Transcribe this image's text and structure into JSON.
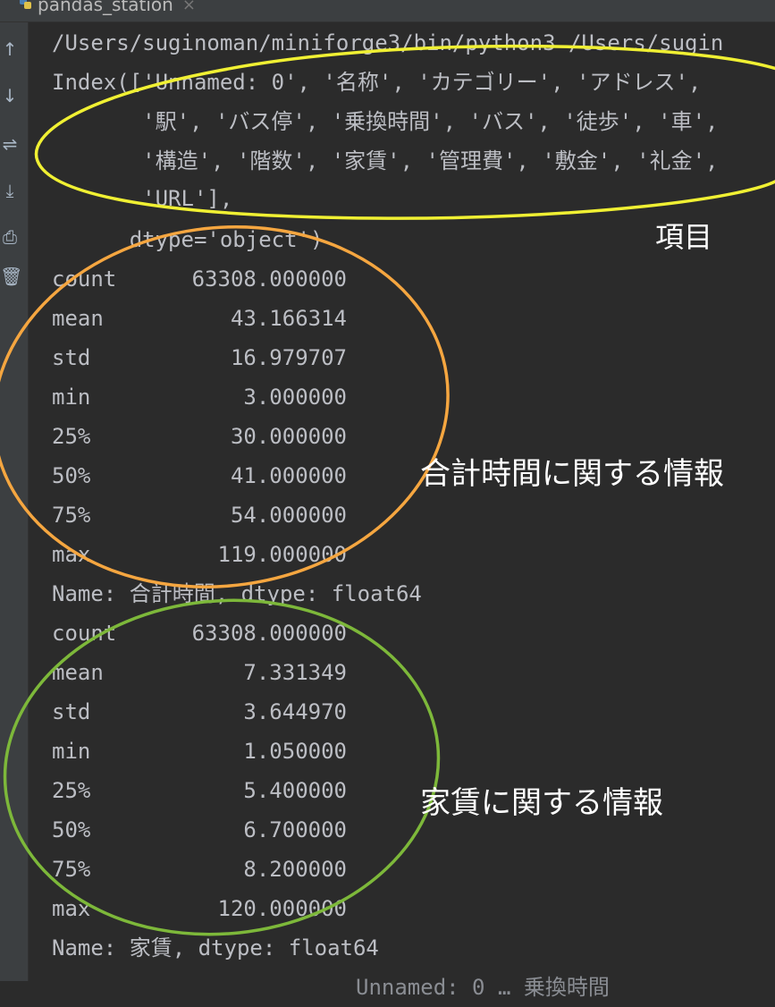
{
  "tab": {
    "title": "pandas_station",
    "close_glyph": "×",
    "icon": "python-file-icon"
  },
  "gutter_icons": [
    "↑",
    "↓",
    "⇌",
    "⤓",
    "⎙",
    "🗑"
  ],
  "console": {
    "cmd": "/Users/suginoman/miniforge3/bin/python3 /Users/sugin",
    "index_lines": [
      "Index(['Unnamed: 0', '名称', 'カテゴリー', 'アドレス',",
      "       '駅', 'バス停', '乗換時間', 'バス', '徒歩', '車',",
      "       '構造', '階数', '家賃', '管理費', '敷金', '礼金',",
      "       'URL'],",
      "      dtype='object')"
    ],
    "stats1": [
      {
        "k": "count",
        "v": "63308.000000"
      },
      {
        "k": "mean",
        "v": "43.166314"
      },
      {
        "k": "std",
        "v": "16.979707"
      },
      {
        "k": "min",
        "v": "3.000000"
      },
      {
        "k": "25%",
        "v": "30.000000"
      },
      {
        "k": "50%",
        "v": "41.000000"
      },
      {
        "k": "75%",
        "v": "54.000000"
      },
      {
        "k": "max",
        "v": "119.000000"
      }
    ],
    "name1": "Name: 合計時間, dtype: float64",
    "stats2": [
      {
        "k": "count",
        "v": "63308.000000"
      },
      {
        "k": "mean",
        "v": "7.331349"
      },
      {
        "k": "std",
        "v": "3.644970"
      },
      {
        "k": "min",
        "v": "1.050000"
      },
      {
        "k": "25%",
        "v": "5.400000"
      },
      {
        "k": "50%",
        "v": "6.700000"
      },
      {
        "k": "75%",
        "v": "8.200000"
      },
      {
        "k": "max",
        "v": "120.000000"
      }
    ],
    "name2": "Name: 家賃, dtype: float64",
    "partial_last": "Unnamed: 0 … 乗換時間"
  },
  "annotations": {
    "items_label": "項目",
    "total_time_label": "合計時間に関する情報",
    "rent_label": "家賃に関する情報"
  },
  "colors": {
    "yellow_circle": "#f0f033",
    "orange_circle": "#f5a640",
    "green_circle": "#7db83a"
  }
}
